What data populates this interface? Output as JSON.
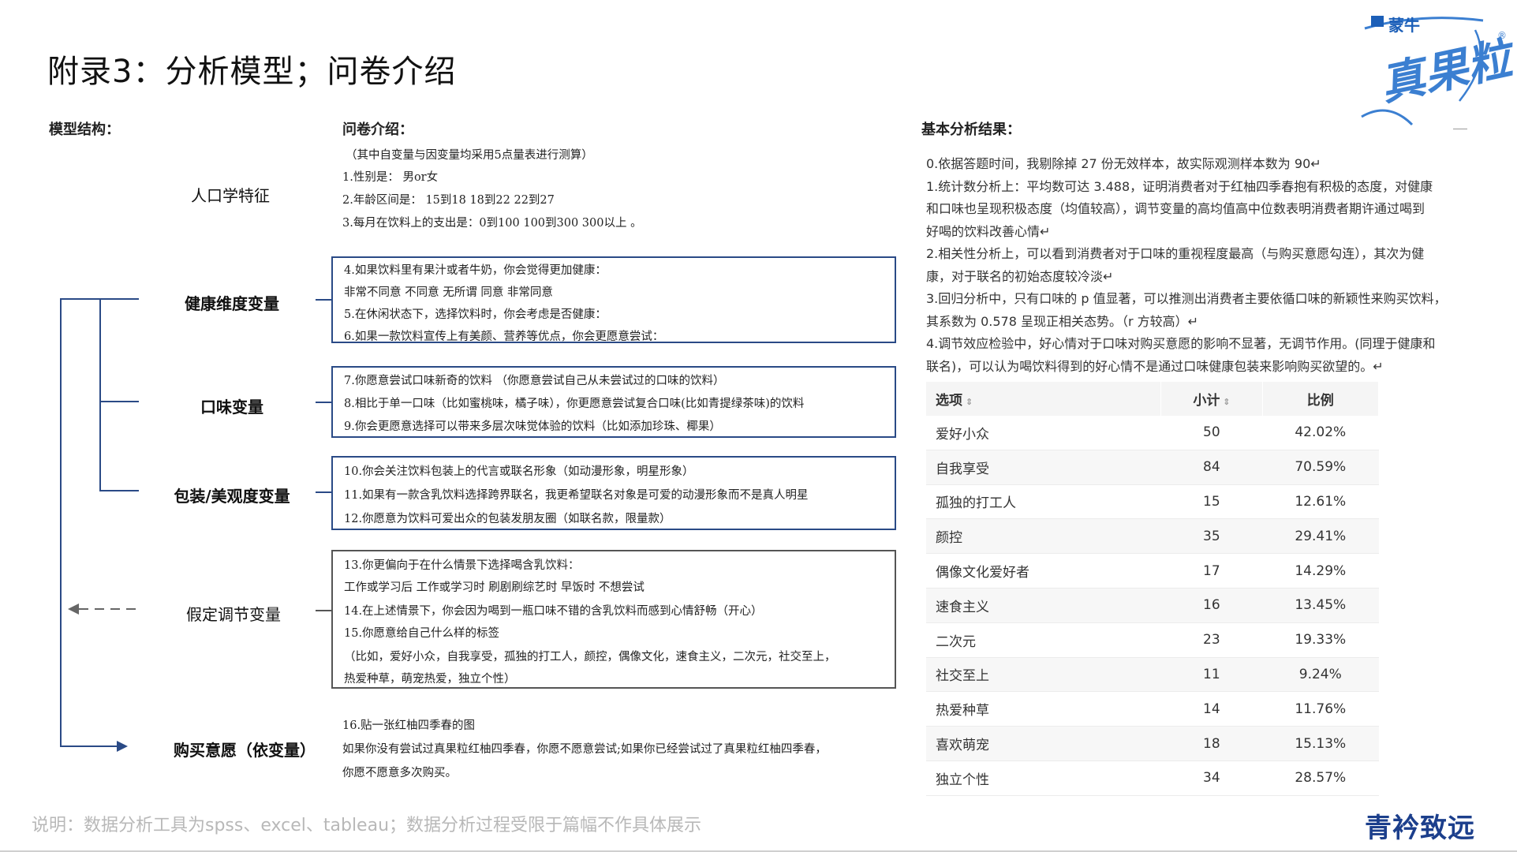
{
  "title": "附录3：分析模型；问卷介绍",
  "logo": {
    "brand": "蒙牛",
    "product": "真果粒",
    "reg": "®"
  },
  "model": {
    "header": "模型结构：",
    "nodes": [
      "人口学特征",
      "健康维度变量",
      "口味变量",
      "包装/美观度变量",
      "假定调节变量",
      "购买意愿（依变量）"
    ]
  },
  "survey": {
    "header": "问卷介绍：",
    "intro": "（其中自变量与因变量均采用5点量表进行测算）",
    "demo": [
      "1.性别是： 男or女",
      "2.年龄区间是： 15到18 18到22 22到27",
      "3.每月在饮料上的支出是：0到100 100到300 300以上 。"
    ],
    "health": [
      "4.如果饮料里有果汁或者牛奶，你会觉得更加健康：",
      " 非常不同意 不同意 无所谓 同意 非常同意",
      "5.在休闲状态下，选择饮料时，你会考虑是否健康：",
      "6.如果一款饮料宣传上有美颜、营养等优点，你会更愿意尝试："
    ],
    "taste": [
      "7.你愿意尝试口味新奇的饮料 （你愿意尝试自己从未尝试过的口味的饮料）",
      "8.相比于单一口味（比如蜜桃味，橘子味），你更愿意尝试复合口味(比如青提绿茶味)的饮料",
      "9.你会更愿意选择可以带来多层次味觉体验的饮料（比如添加珍珠、椰果）"
    ],
    "package": [
      "10.你会关注饮料包装上的代言或联名形象（如动漫形象，明星形象）",
      "11.如果有一款含乳饮料选择跨界联名，我更希望联名对象是可爱的动漫形象而不是真人明星",
      "12.你愿意为饮料可爱出众的包装发朋友圈（如联名款，限量款）"
    ],
    "moderator": [
      "13.你更偏向于在什么情景下选择喝含乳饮料：",
      " 工作或学习后 工作或学习时 刷剧刷综艺时 早饭时 不想尝试",
      "14.在上述情景下，你会因为喝到一瓶口味不错的含乳饮料而感到心情舒畅（开心）",
      "15.你愿意给自己什么样的标签",
      "（比如，爱好小众，自我享受，孤独的打工人，颜控，偶像文化，速食主义，二次元，社交至上，",
      "热爱种草，萌宠热爱，独立个性）"
    ],
    "purchase": [
      "16.贴一张红柚四季春的图",
      " 如果你没有尝试过真果粒红柚四季春，你愿不愿意尝试;如果你已经尝试过了真果粒红柚四季春，",
      "你愿不愿意多次购买。"
    ]
  },
  "results": {
    "header": "基本分析结果：",
    "paragraphs": [
      "0.依据答题时间，我剔除掉 27 份无效样本，故实际观测样本数为 90↵",
      "1.统计数分析上：平均数可达 3.488，证明消费者对于红柚四季春抱有积极的态度，对健康",
      "和口味也呈现积极态度（均值较高），调节变量的高均值高中位数表明消费者期许通过喝到",
      "好喝的饮料改善心情↵",
      "2.相关性分析上，可以看到消费者对于口味的重视程度最高（与购买意愿勾连），其次为健",
      "康，对于联名的初始态度较冷淡↵",
      "3.回归分析中，只有口味的 p 值显著，可以推测出消费者主要依循口味的新颖性来购买饮料，",
      "其系数为 0.578 呈现正相关态势。（r 方较高）↵",
      "4.调节效应检验中，好心情对于口味对购买意愿的影响不显著，无调节作用。(同理于健康和",
      "联名)，可以认为喝饮料得到的好心情不是通过口味健康包装来影响购买欲望的。↵"
    ],
    "table": {
      "headers": [
        "选项",
        "小计",
        "比例"
      ],
      "sort_icon": "sort-icon",
      "rows": [
        [
          "爱好小众",
          "50",
          "42.02%"
        ],
        [
          "自我享受",
          "84",
          "70.59%"
        ],
        [
          "孤独的打工人",
          "15",
          "12.61%"
        ],
        [
          "颜控",
          "35",
          "29.41%"
        ],
        [
          "偶像文化爱好者",
          "17",
          "14.29%"
        ],
        [
          "速食主义",
          "16",
          "13.45%"
        ],
        [
          "二次元",
          "23",
          "19.33%"
        ],
        [
          "社交至上",
          "11",
          "9.24%"
        ],
        [
          "热爱种草",
          "14",
          "11.76%"
        ],
        [
          "喜欢萌宠",
          "18",
          "15.13%"
        ],
        [
          "独立个性",
          "34",
          "28.57%"
        ]
      ]
    }
  },
  "footer": {
    "note": "说明：数据分析工具为spss、excel、tableau；数据分析过程受限于篇幅不作具体展示",
    "brand": "青衿致远"
  },
  "colors": {
    "frame_blue": "#2a4a86",
    "brand_blue": "#1c3f8c",
    "logo_blue": "#3b7fd1"
  }
}
